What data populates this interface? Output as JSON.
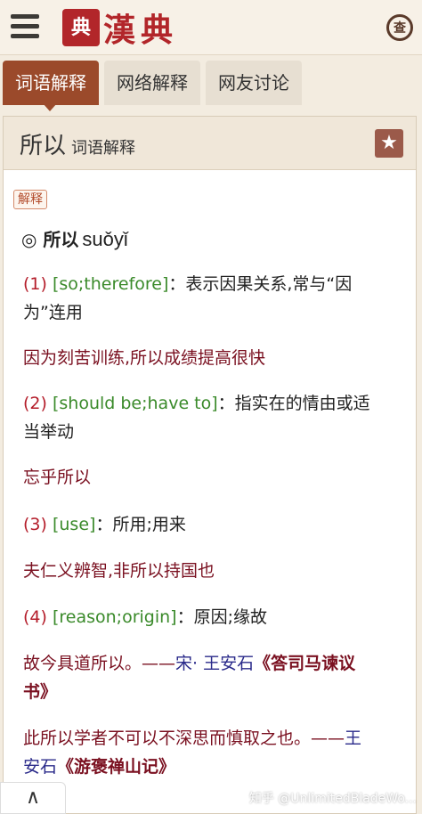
{
  "header": {
    "seal_text": "典",
    "logo_text": "漢典",
    "search_icon_text": "查"
  },
  "tabs": [
    {
      "label": "词语解释",
      "active": true
    },
    {
      "label": "网络解释",
      "active": false
    },
    {
      "label": "网友讨论",
      "active": false
    }
  ],
  "card": {
    "title": "所以",
    "subtitle": "词语解释",
    "badge": "解释",
    "entry_word": "◎ 所以",
    "entry_pinyin": "suǒyǐ"
  },
  "senses": [
    {
      "num": "(1)",
      "en": "[so;therefore]",
      "def_1": "：表示因果关系,常与“因",
      "def_2": "为”连用",
      "example": "因为刻苦训练,所以成绩提高很快"
    },
    {
      "num": "(2)",
      "en": "[should be;have to]",
      "def_1": "：指实在的情由或适",
      "def_2": "当举动",
      "example": "忘乎所以"
    },
    {
      "num": "(3)",
      "en": "[use]",
      "def_1": "：所用;用来",
      "example": "夫仁义辨智,非所以持国也"
    },
    {
      "num": "(4)",
      "en": "[reason;origin]",
      "def_1": "：原因;缘故",
      "quote_1": {
        "text": "故今具道所以。——",
        "author": "宋· 王安石",
        "book_a": "《答司马谏议",
        "book_b": "书》"
      },
      "quote_2": {
        "text": "此所以学者不可以不深思而慎取之也。——",
        "author_a": "王",
        "author_b": "安石",
        "book": "《游褒禅山记》"
      }
    }
  ],
  "footer": {
    "up_icon": "∧",
    "watermark": "知乎 @UnlimitedBladeWo..."
  }
}
